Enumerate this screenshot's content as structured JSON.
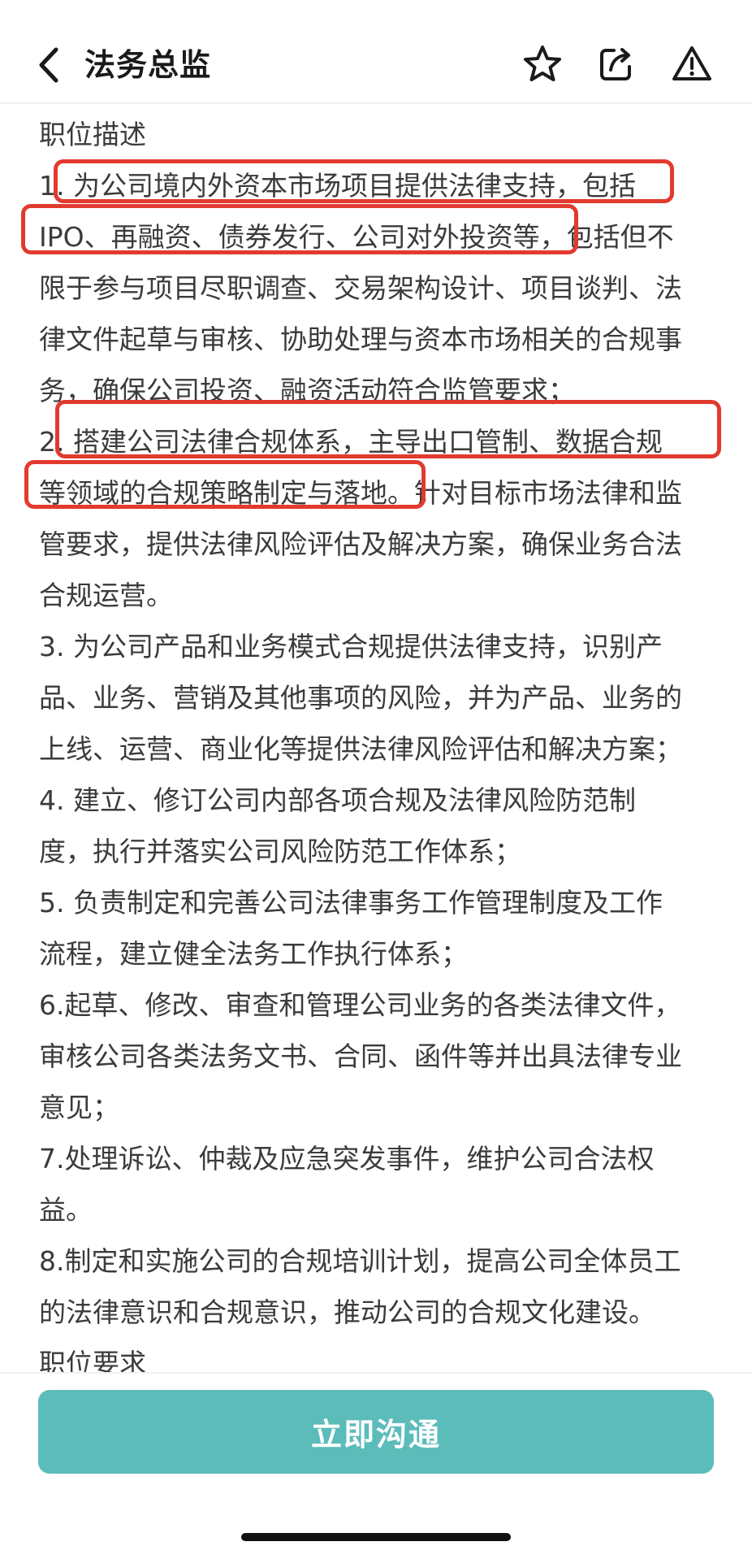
{
  "header": {
    "title": "法务总监",
    "icons": [
      "back-arrow-icon",
      "star-icon",
      "share-icon",
      "alert-icon"
    ]
  },
  "content": {
    "lines": [
      "职位描述",
      "1. 为公司境内外资本市场项目提供法律支持，包括",
      "IPO、再融资、债券发行、公司对外投资等，包括但不",
      "限于参与项目尽职调查、交易架构设计、项目谈判、法",
      "律文件起草与审核、协助处理与资本市场相关的合规事",
      "务，确保公司投资、融资活动符合监管要求；",
      "2. 搭建公司法律合规体系，主导出口管制、数据合规",
      "等领域的合规策略制定与落地。针对目标市场法律和监",
      "管要求，提供法律风险评估及解决方案，确保业务合法",
      "合规运营。",
      "3. 为公司产品和业务模式合规提供法律支持，识别产",
      "品、业务、营销及其他事项的风险，并为产品、业务的",
      "上线、运营、商业化等提供法律风险评估和解决方案；",
      "4. 建立、修订公司内部各项合规及法律风险防范制",
      "度，执行并落实公司风险防范工作体系；",
      "5. 负责制定和完善公司法律事务工作管理制度及工作",
      "流程，建立健全法务工作执行体系；",
      "6.起草、修改、审查和管理公司业务的各类法律文件，",
      "审核公司各类法务文书、合同、函件等并出具法律专业",
      "意见；",
      "7.处理诉讼、仲裁及应急突发事件，维护公司合法权",
      "益。",
      "8.制定和实施公司的合规培训计划，提高公司全体员工",
      "的法律意识和合规意识，推动公司的合规文化建设。",
      "职位要求"
    ]
  },
  "cta": {
    "label": "立即沟通"
  },
  "colors": {
    "accent": "#5bbcba",
    "annotation": "#e23a2e",
    "text": "#3b3b3b"
  }
}
